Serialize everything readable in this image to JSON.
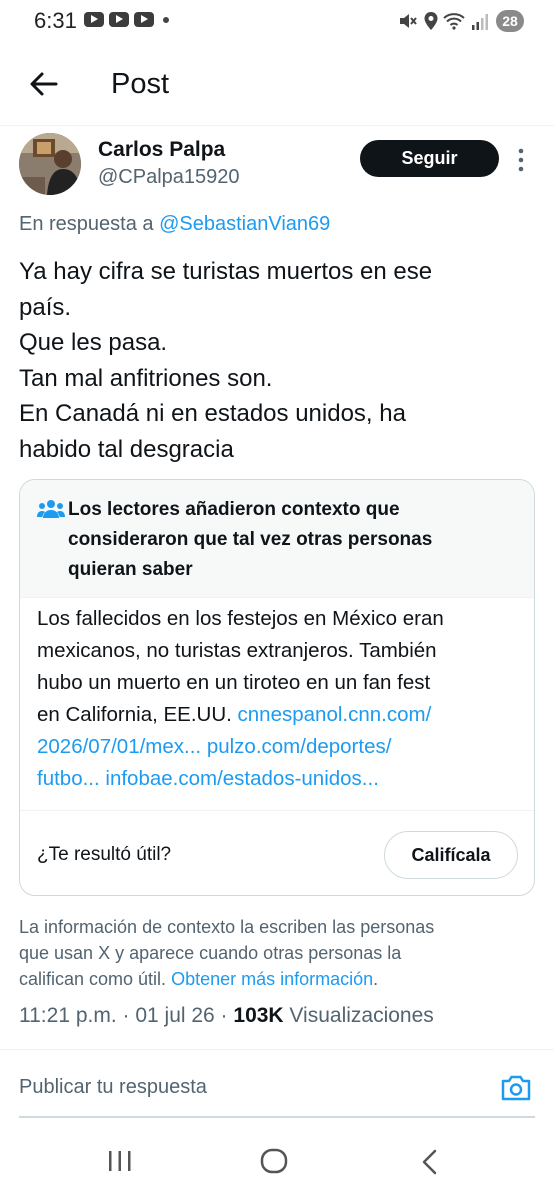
{
  "status_bar": {
    "time": "6:31",
    "battery": "28",
    "icons": [
      "youtube-icon",
      "youtube-icon",
      "youtube-icon",
      "mute-icon",
      "location-icon",
      "wifi-icon",
      "signal-icon"
    ]
  },
  "header": {
    "title": "Post",
    "back_icon": "back-arrow-icon"
  },
  "post": {
    "author_name": "Carlos Palpa",
    "author_handle": "@CPalpa15920",
    "follow_label": "Seguir",
    "reply_prefix": "En respuesta a ",
    "reply_mention": "@SebastianVian69",
    "text_lines": [
      "Ya hay cifra se turistas muertos en ese",
      "país.",
      "Que les pasa.",
      "Tan mal anfitriones son.",
      "En Canadá ni en estados unidos, ha",
      "habido tal desgracia"
    ],
    "timestamp": "11:21 p.m. · 01 jul 26 · ",
    "views_count": "103K",
    "views_label": " Visualizaciones"
  },
  "community_note": {
    "title_lines": [
      "Los lectores añadieron contexto que",
      "consideraron que tal vez otras personas",
      "quieran saber"
    ],
    "body_line1": "Los fallecidos en los festejos en México eran",
    "body_line2": "mexicanos, no turistas extranjeros. También",
    "body_line3": "hubo un muerto en un tiroteo en un fan fest",
    "body_line4_text": "en California, EE.UU. ",
    "link1_part1": "cnnespanol.cnn.com/",
    "link1_part2": "2026/07/01/mex...",
    "link2_part1": "pulzo.com/deportes/",
    "link2_part2": "futbo...",
    "link3": "infobae.com/estados-unidos...",
    "helpful_question": "¿Te resultó útil?",
    "rate_label": "Califícala"
  },
  "context_info": {
    "line1": "La información de contexto la escriben las personas",
    "line2": "que usan X y aparece cuando otras personas la",
    "line3_text": "califican como útil. ",
    "line3_link": "Obtener más información",
    "line3_end": "."
  },
  "reply": {
    "placeholder": "Publicar tu respuesta"
  },
  "colors": {
    "link": "#1d9bf0",
    "text_primary": "#0f1419",
    "text_secondary": "#536471",
    "border": "#cfd9de",
    "follow_bg": "#0f1419"
  }
}
